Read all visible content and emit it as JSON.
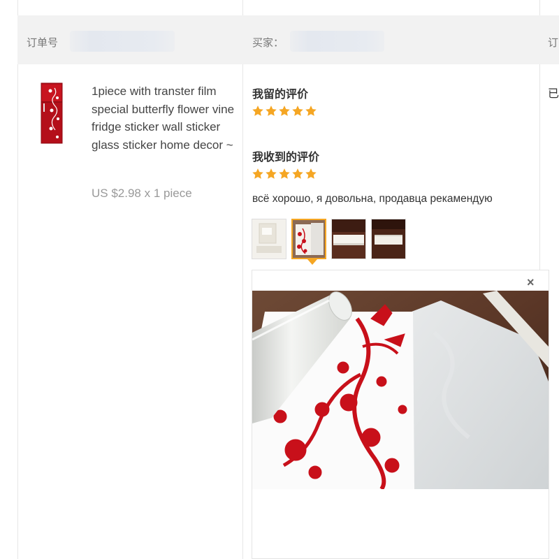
{
  "header": {
    "order_label": "订单号",
    "buyer_label": "买家：",
    "third_label": "订"
  },
  "product": {
    "title": "1piece with transter film special butterfly flower vine fridge sticker wall sticker glass sticker home decor ~",
    "price": "US $2.98 x 1 piece",
    "thumbnail_icon": "product-image"
  },
  "feedback": {
    "my_review_heading": "我留的评价",
    "my_rating": 5,
    "received_review_heading": "我收到的评价",
    "received_rating": 5,
    "review_text": "всё хорошо, я довольна, продавца рекамендую",
    "photo_count": 4,
    "active_photo_index": 1,
    "close_label": "×"
  },
  "status": {
    "text": "已"
  },
  "colors": {
    "star": "#f5a623",
    "header_bg": "#f2f2f2",
    "accent_red": "#c8101a"
  }
}
